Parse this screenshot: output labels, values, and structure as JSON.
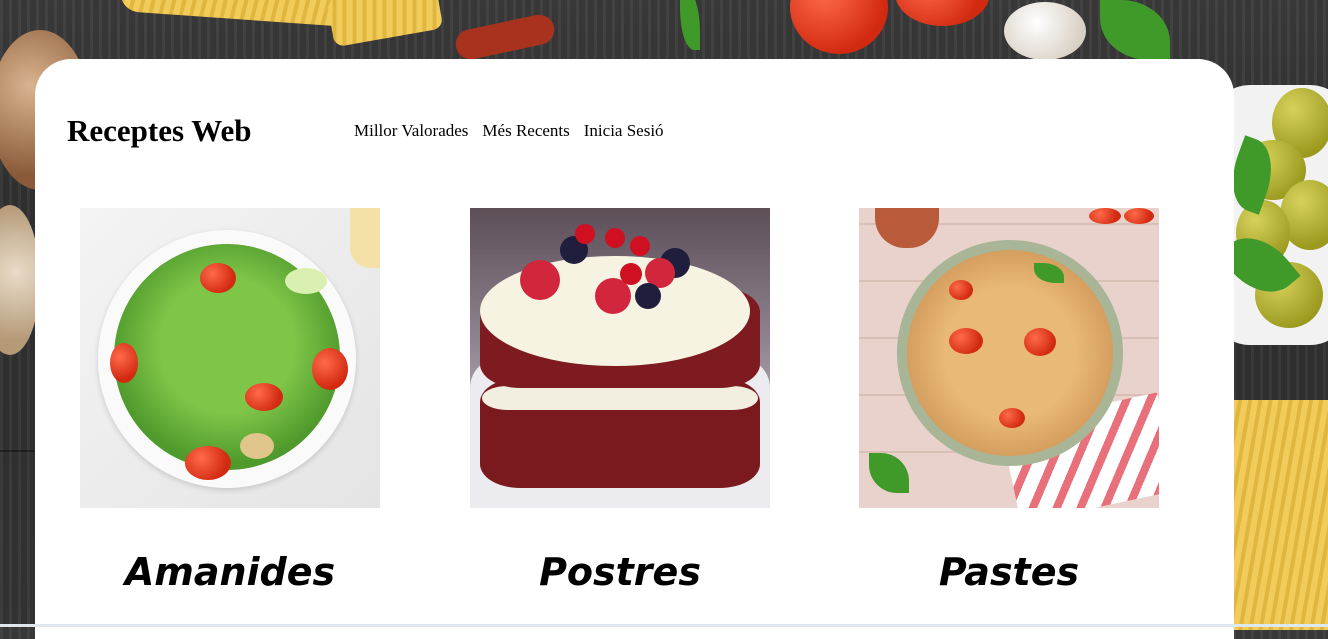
{
  "header": {
    "site_title": "Receptes Web",
    "nav": [
      "Millor Valorades",
      "Més Recents",
      "Inicia Sesió"
    ]
  },
  "categories": [
    {
      "label": "Amanides",
      "image": "salad-photo"
    },
    {
      "label": "Postres",
      "image": "red-velvet-cake-photo"
    },
    {
      "label": "Pastes",
      "image": "pasta-bowl-photo"
    }
  ]
}
